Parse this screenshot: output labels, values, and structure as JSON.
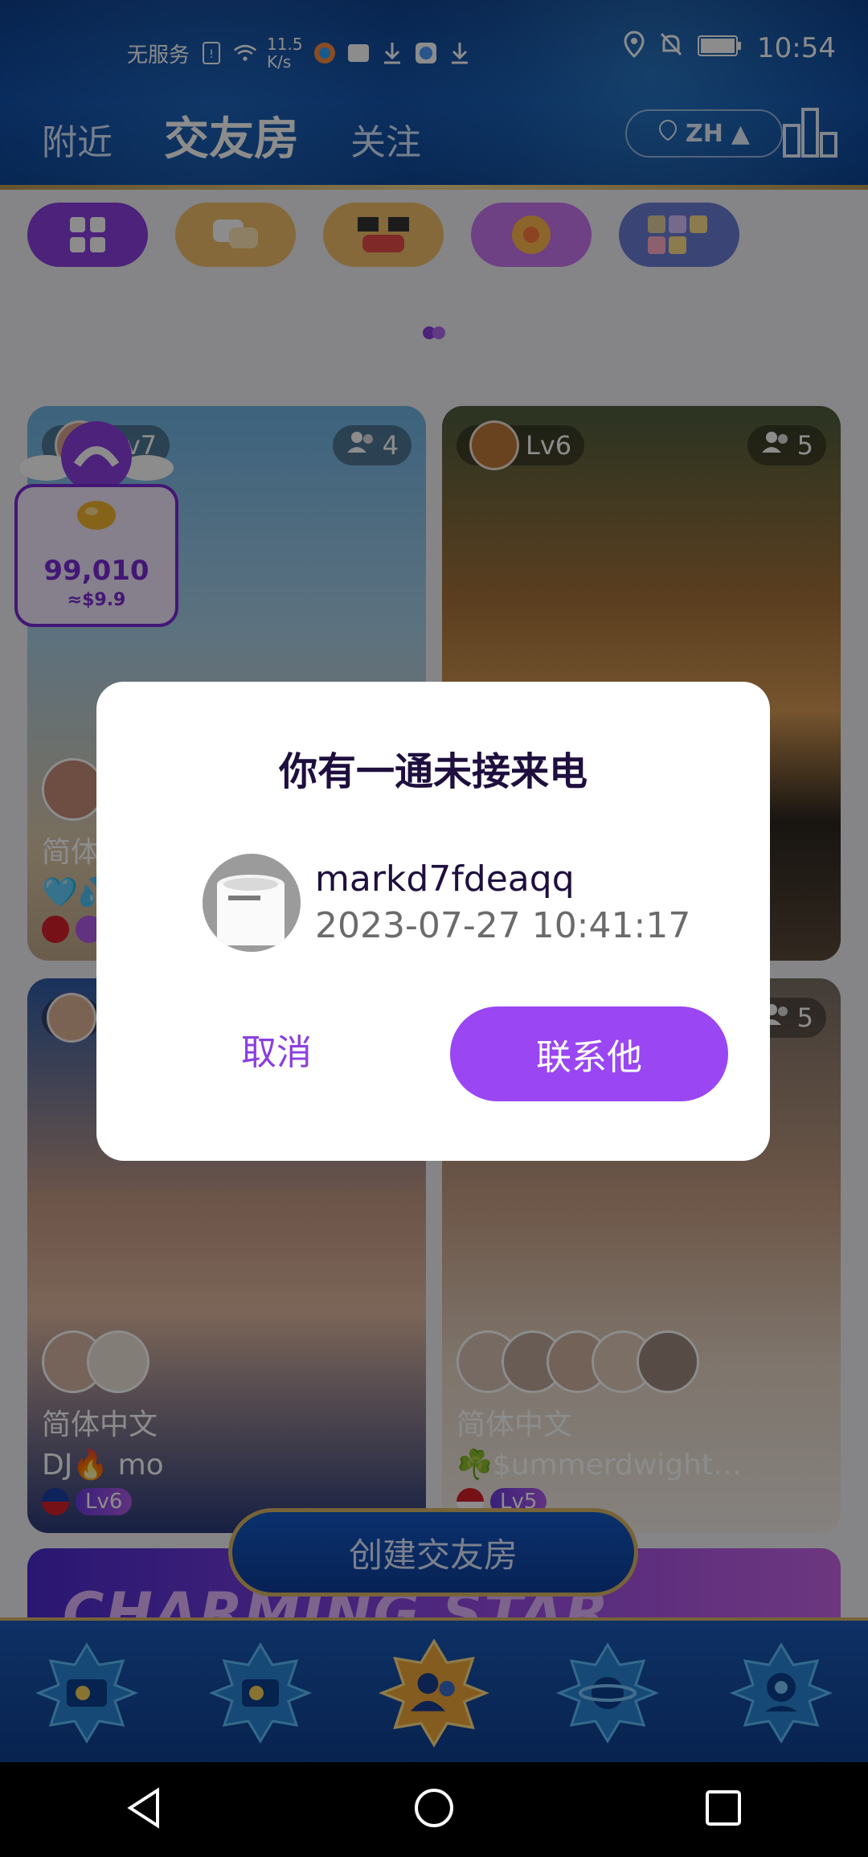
{
  "statusbar": {
    "carrier": "无服务",
    "net_speed": "11.5\nK/s",
    "time": "10:54"
  },
  "header": {
    "tabs": [
      {
        "label": "附近",
        "active": false
      },
      {
        "label": "交友房",
        "active": true
      },
      {
        "label": "关注",
        "active": false
      }
    ],
    "language": "ZH"
  },
  "rooms": [
    {
      "level": "Lv7",
      "members": "4",
      "lang": "简体",
      "title": "🩵💦",
      "flag": "vn"
    },
    {
      "level": "Lv6",
      "members": "5",
      "lang": "",
      "title": "",
      "flag": ""
    },
    {
      "level": "",
      "members": "",
      "lang": "简体中文",
      "title": "DJ🔥 mo",
      "flag": "ph",
      "lv_pill": "Lv6"
    },
    {
      "level": "",
      "members": "5",
      "lang": "简体中文",
      "title": "☘️$ummerdwight…",
      "flag": "sg",
      "lv_pill": "Lv5"
    }
  ],
  "beans": {
    "amount": "99,010",
    "usd": "≈$9.9"
  },
  "create_room_label": "创建交友房",
  "banner_text": "CHARMING STAR",
  "dialog": {
    "title": "你有一通未接来电",
    "username": "markd7fdeaqq",
    "datetime": "2023-07-27 10:41:17",
    "cancel": "取消",
    "contact": "联系他"
  },
  "colors": {
    "accent": "#9a46f3",
    "header_bg": "#0d4aa5",
    "gold": "#d9b566"
  },
  "icons": {
    "bottom_tabs": [
      "party-camera-icon",
      "party-camera-icon-2",
      "friends-room-icon",
      "planet-icon",
      "profile-icon"
    ]
  }
}
